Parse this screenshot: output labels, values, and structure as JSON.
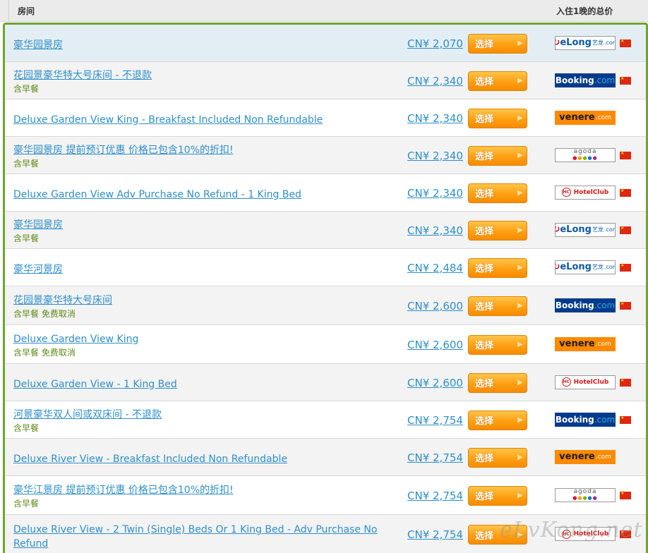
{
  "header": {
    "room_col": "房间",
    "price_col": "入住1晚的总价"
  },
  "button_label": "选择",
  "watermark": "eLvKong.net",
  "rows": [
    {
      "title": "豪华园景房",
      "note": "",
      "price": "CN¥ 2,070",
      "provider": "elong",
      "flag": true
    },
    {
      "title": "花园景豪华特大号床间 - 不退款",
      "note": "含早餐",
      "price": "CN¥ 2,340",
      "provider": "booking",
      "flag": true
    },
    {
      "title": "Deluxe Garden View King - Breakfast Included Non Refundable",
      "note": "",
      "price": "CN¥ 2,340",
      "provider": "venere",
      "flag": false
    },
    {
      "title": "豪华园景房 提前预订优惠 价格已包含10%的折扣!",
      "note": "含早餐",
      "price": "CN¥ 2,340",
      "provider": "agoda",
      "flag": true
    },
    {
      "title": "Deluxe Garden View Adv Purchase No Refund - 1 King Bed",
      "note": "",
      "price": "CN¥ 2,340",
      "provider": "hotelclub",
      "flag": true
    },
    {
      "title": "豪华园景房",
      "note": "含早餐",
      "price": "CN¥ 2,340",
      "provider": "elong",
      "flag": true
    },
    {
      "title": "豪华河景房",
      "note": "",
      "price": "CN¥ 2,484",
      "provider": "elong",
      "flag": true
    },
    {
      "title": "花园景豪华特大号床间",
      "note": "含早餐 免费取消",
      "price": "CN¥ 2,600",
      "provider": "booking",
      "flag": true
    },
    {
      "title": "Deluxe Garden View King",
      "note": "含早餐 免费取消",
      "price": "CN¥ 2,600",
      "provider": "venere",
      "flag": false
    },
    {
      "title": "Deluxe Garden View - 1 King Bed",
      "note": "",
      "price": "CN¥ 2,600",
      "provider": "hotelclub",
      "flag": true
    },
    {
      "title": "河景豪华双人间或双床间 - 不退款",
      "note": "含早餐",
      "price": "CN¥ 2,754",
      "provider": "booking",
      "flag": true
    },
    {
      "title": "Deluxe River View - Breakfast Included Non Refundable",
      "note": "",
      "price": "CN¥ 2,754",
      "provider": "venere",
      "flag": false
    },
    {
      "title": "豪华江景房 提前预订优惠 价格已包含10%的折扣!",
      "note": "含早餐",
      "price": "CN¥ 2,754",
      "provider": "agoda",
      "flag": true
    },
    {
      "title": "Deluxe River View - 2 Twin (Single) Beds Or 1 King Bed - Adv Purchase No Refund",
      "note": "",
      "price": "CN¥ 2,754",
      "provider": "hotelclub",
      "flag": true
    }
  ],
  "providers": {
    "elong": {
      "main": "eLong",
      "prefix": "e",
      "suffix": ".com",
      "tag": "艺龙"
    },
    "booking": {
      "main": "Booking",
      "suffix": ".com"
    },
    "venere": {
      "main": "venere",
      "suffix": ".com"
    },
    "agoda": {
      "main": "agoda"
    },
    "hotelclub": {
      "badge": "HC",
      "main": "HotelClub"
    }
  },
  "colors": {
    "link": "#2e8fc9",
    "note": "#5c8a19",
    "border_green": "#6fa52c",
    "button_orange": "#ff9f12",
    "row_highlight": "#e3eef4"
  }
}
